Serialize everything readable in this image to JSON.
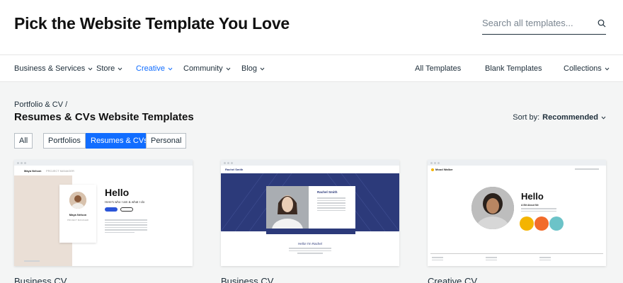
{
  "header": {
    "title": "Pick the Website Template You Love",
    "search_placeholder": "Search all templates..."
  },
  "nav": {
    "left": [
      {
        "label": "Business & Services",
        "active": false
      },
      {
        "label": "Store",
        "active": false
      },
      {
        "label": "Creative",
        "active": true
      },
      {
        "label": "Community",
        "active": false
      },
      {
        "label": "Blog",
        "active": false
      }
    ],
    "right": [
      {
        "label": "All Templates"
      },
      {
        "label": "Blank Templates"
      },
      {
        "label": "Collections"
      }
    ]
  },
  "breadcrumb": "Portfolio & CV /",
  "section_title": "Resumes & CVs Website Templates",
  "sort": {
    "label": "Sort by:",
    "value": "Recommended"
  },
  "filters": [
    {
      "label": "All",
      "selected": false
    },
    {
      "label": "Portfolios",
      "selected": false
    },
    {
      "label": "Resumes & CVs",
      "selected": true
    },
    {
      "label": "Personal",
      "selected": false
    }
  ],
  "cards": [
    {
      "name": "Business CV",
      "preview": {
        "brand": "Maya Nelson",
        "brand_sub": "PROJECT MANAGER",
        "hello": "Hello",
        "tagline": "Here's who I am & what I do",
        "person_name": "Maya Nelson",
        "person_role": "PROJECT MANAGER"
      }
    },
    {
      "name": "Business CV",
      "preview": {
        "brand": "Rachel Smith",
        "person_name": "Rachel Smith",
        "hello": "Hello! I'm Rachel"
      }
    },
    {
      "name": "Creative CV",
      "preview": {
        "brand": "Mood Walker",
        "hello": "Hello",
        "sub": "A Bit About Me"
      }
    }
  ],
  "colors": {
    "accent": "#116dff",
    "card2_blue": "#2c3a7a",
    "card1_beige": "#eadfd6",
    "card3_yellow": "#f4b400",
    "card3_orange": "#f26b2a",
    "card3_teal": "#6cc3c8"
  }
}
